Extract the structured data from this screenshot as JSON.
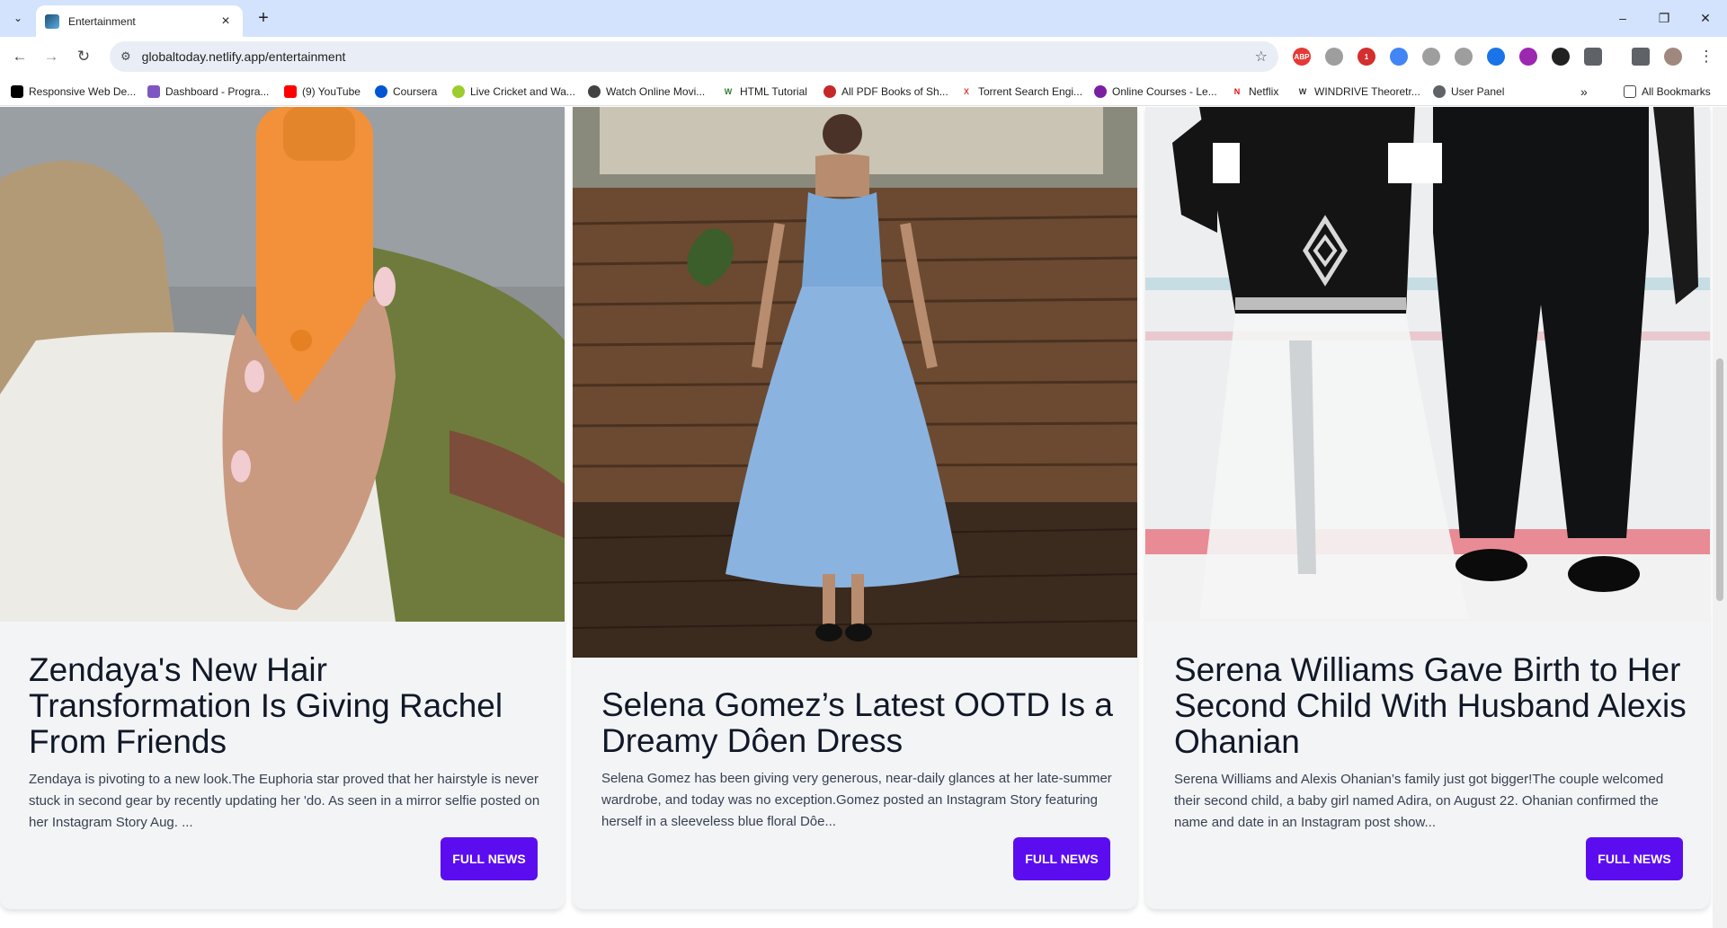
{
  "browser": {
    "tab_title": "Entertainment",
    "url": "globaltoday.netlify.app/entertainment",
    "extension_badge": "1",
    "bookmarks": [
      "Responsive Web De...",
      "Dashboard - Progra...",
      "(9) YouTube",
      "Coursera",
      "Live Cricket and Wa...",
      "Watch Online Movi...",
      "HTML Tutorial",
      "All PDF Books of Sh...",
      "Torrent Search Engi...",
      "Online Courses - Le...",
      "Netflix",
      "WINDRIVE Theoretr...",
      "User Panel"
    ],
    "all_bookmarks": "All Bookmarks"
  },
  "cards": [
    {
      "title": "Zendaya's New Hair Transformation Is Giving Rachel From Friends",
      "excerpt": "Zendaya is pivoting to a new look.The Euphoria star proved that her hairstyle is never stuck in second gear by recently updating her 'do. As seen in a mirror selfie posted on her Instagram Story Aug. ...",
      "button": "FULL NEWS"
    },
    {
      "title": "Selena Gomez’s Latest OOTD Is a Dreamy Dôen Dress",
      "excerpt": "Selena Gomez has been giving very generous, near-daily glances at her late-summer wardrobe, and today was no exception.Gomez posted an Instagram Story featuring herself in a sleeveless blue floral Dôe...",
      "button": "FULL NEWS"
    },
    {
      "title": "Serena Williams Gave Birth to Her Second Child With Husband Alexis Ohanian",
      "excerpt": "Serena Williams and Alexis Ohanian’s family just got bigger!The couple welcomed their second child, a baby girl named Adira, on August 22. Ohanian confirmed the name and date in an Instagram post show...",
      "button": "FULL NEWS"
    }
  ]
}
